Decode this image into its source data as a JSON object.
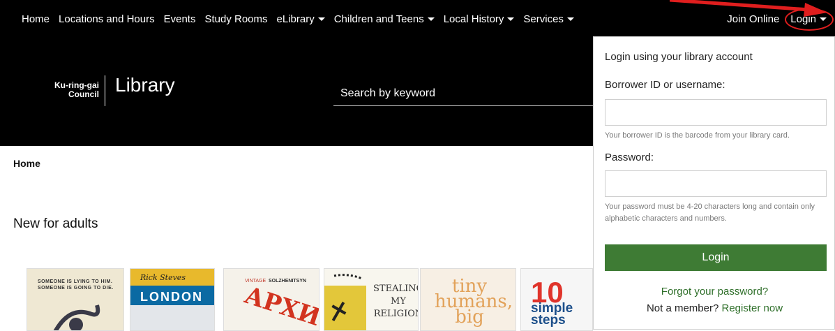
{
  "nav": {
    "items": [
      {
        "label": "Home",
        "dropdown": false
      },
      {
        "label": "Locations and Hours",
        "dropdown": false
      },
      {
        "label": "Events",
        "dropdown": false
      },
      {
        "label": "Study Rooms",
        "dropdown": false
      },
      {
        "label": "eLibrary",
        "dropdown": true
      },
      {
        "label": "Children and Teens",
        "dropdown": true
      },
      {
        "label": "Local History",
        "dropdown": true
      },
      {
        "label": "Services",
        "dropdown": true
      }
    ],
    "join_label": "Join Online",
    "login_label": "Login"
  },
  "header": {
    "logo_council_line1": "Ku-ring-gai",
    "logo_council_line2": "Council",
    "logo_library": "Library",
    "search_placeholder": "Search by keyword"
  },
  "breadcrumb": "Home",
  "section_title": "New for adults",
  "books": [
    {
      "line1": "SOMEONE IS LYING TO HIM.",
      "line2": "SOMEONE IS GOING TO DIE."
    },
    {
      "author": "Rick Steves",
      "title": "LONDON"
    },
    {
      "imprint": "VINTAGE",
      "author": "SOLZHENITSYN",
      "title": "АРХИ"
    },
    {
      "line1": "STEALING",
      "line2": "MY",
      "line3": "RELIGION"
    },
    {
      "line1": "tiny",
      "line2": "humans,",
      "line3": "big"
    },
    {
      "line1": "10",
      "line2": "simple",
      "line3": "steps"
    }
  ],
  "login_panel": {
    "heading": "Login using your library account",
    "borrower_label": "Borrower ID or username:",
    "borrower_value": "",
    "borrower_hint": "Your borrower ID is the barcode from your library card.",
    "password_label": "Password:",
    "password_value": "",
    "password_hint": "Your password must be 4-20 characters long and contain only alphabetic characters and numbers.",
    "login_button": "Login",
    "forgot_link": "Forgot your password?",
    "member_text": "Not a member?",
    "register_link": "Register now"
  },
  "colors": {
    "nav_bg": "#000000",
    "button_green": "#3e7b34",
    "link_green": "#2f6f2a",
    "annotation_red": "#e01e1e"
  }
}
